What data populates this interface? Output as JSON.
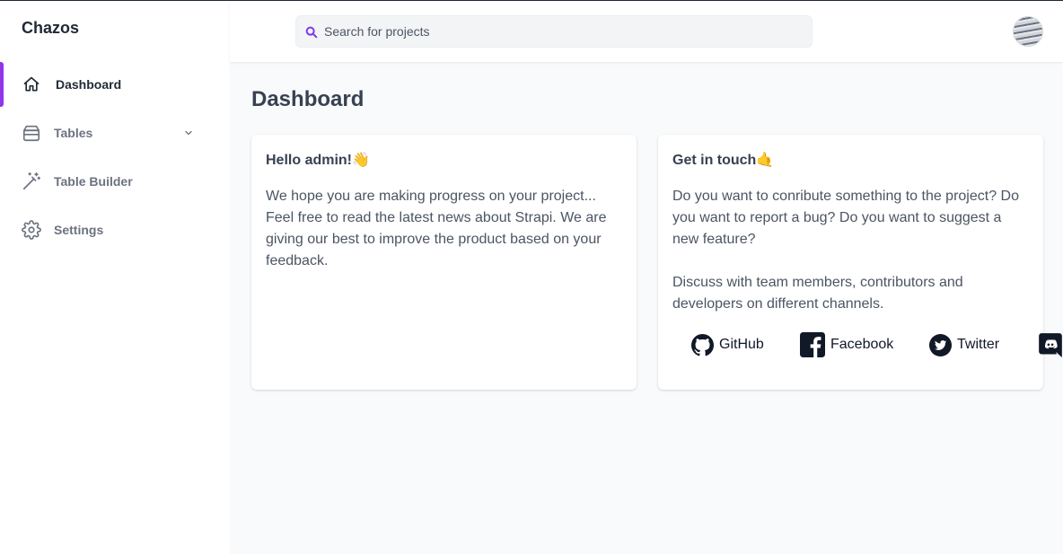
{
  "app": {
    "brand": "Chazos"
  },
  "sidebar": {
    "items": [
      {
        "label": "Dashboard",
        "icon": "home-icon",
        "active": true
      },
      {
        "label": "Tables",
        "icon": "database-icon",
        "expandable": true
      },
      {
        "label": "Table Builder",
        "icon": "magic-wand-icon"
      },
      {
        "label": "Settings",
        "icon": "gear-icon"
      }
    ]
  },
  "search": {
    "placeholder": "Search for projects",
    "value": ""
  },
  "header": {
    "avatar": "user-avatar"
  },
  "main": {
    "title": "Dashboard",
    "cards": [
      {
        "title": "Hello admin!👋",
        "paragraphs": [
          "We hope you are making progress on your project... Feel free to read the latest news about Strapi. We are giving our best to improve the product based on your feedback."
        ]
      },
      {
        "title": "Get in touch🤙",
        "paragraphs": [
          "Do you want to conribute something to the project? Do you want to report a bug? Do you want to suggest a new feature?",
          "Discuss with team members, contributors and developers on different channels."
        ],
        "links": [
          {
            "label": "GitHub",
            "icon": "github-icon"
          },
          {
            "label": "Facebook",
            "icon": "facebook-icon"
          },
          {
            "label": "Twitter",
            "icon": "twitter-icon"
          },
          {
            "label": "",
            "icon": "discord-icon"
          }
        ]
      }
    ]
  },
  "colors": {
    "accent": "#9333ea",
    "sidebar_bg": "#ffffff",
    "page_bg": "#f9fafb"
  }
}
